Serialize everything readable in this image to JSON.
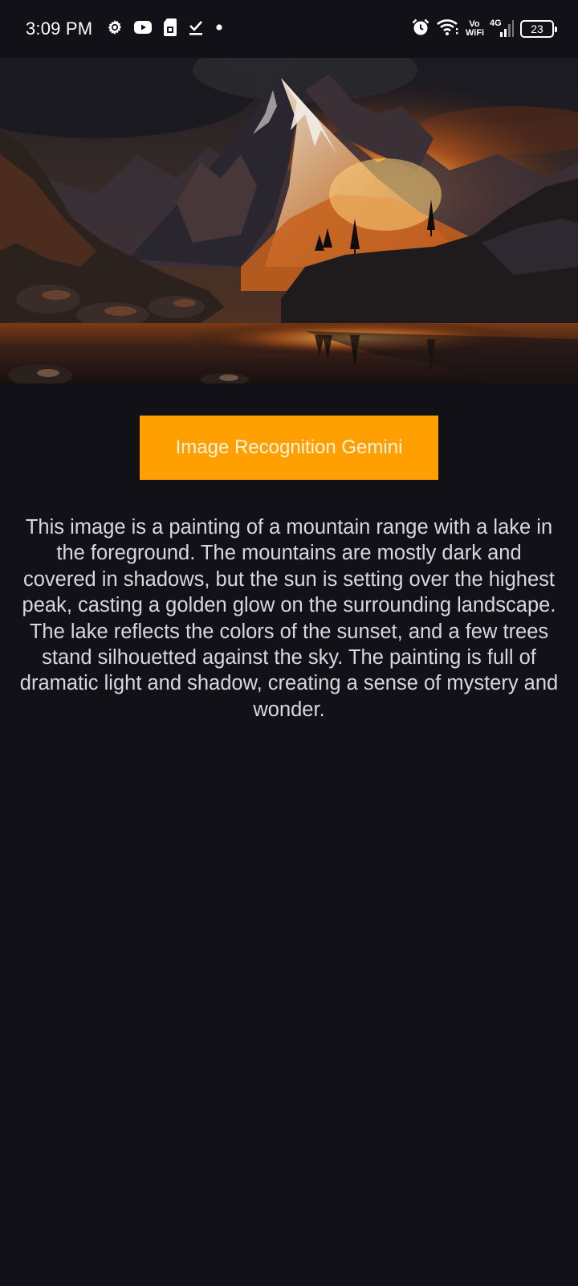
{
  "status_bar": {
    "time": "3:09 PM",
    "left_icons": [
      "settings-gear-icon",
      "youtube-icon",
      "sim-card-icon",
      "download-done-icon",
      "notification-dot-icon"
    ],
    "right_icons": [
      "alarm-icon",
      "wifi-icon",
      "volte-wifi-icon",
      "mobile-signal-4g-icon",
      "battery-icon"
    ],
    "volte_line1": "Vo",
    "volte_line2": "WiFi",
    "network_type": "4G",
    "battery_level": "23",
    "battery_fraction": 0.23
  },
  "hero_image": {
    "icon": "mountain-lake-sunset-painting"
  },
  "action": {
    "button_label": "Image Recognition Gemini",
    "button_color": "#ffa000"
  },
  "result": {
    "description": "This image is a painting of a mountain range with a lake in the foreground. The mountains are mostly dark and covered in shadows, but the sun is setting over the highest peak, casting a golden glow on the surrounding landscape. The lake reflects the colors of the sunset, and a few trees stand silhouetted against the sky. The painting is full of dramatic light and shadow, creating a sense of mystery and wonder."
  },
  "theme": {
    "background": "#131118",
    "text_color": "#d9d6de"
  }
}
